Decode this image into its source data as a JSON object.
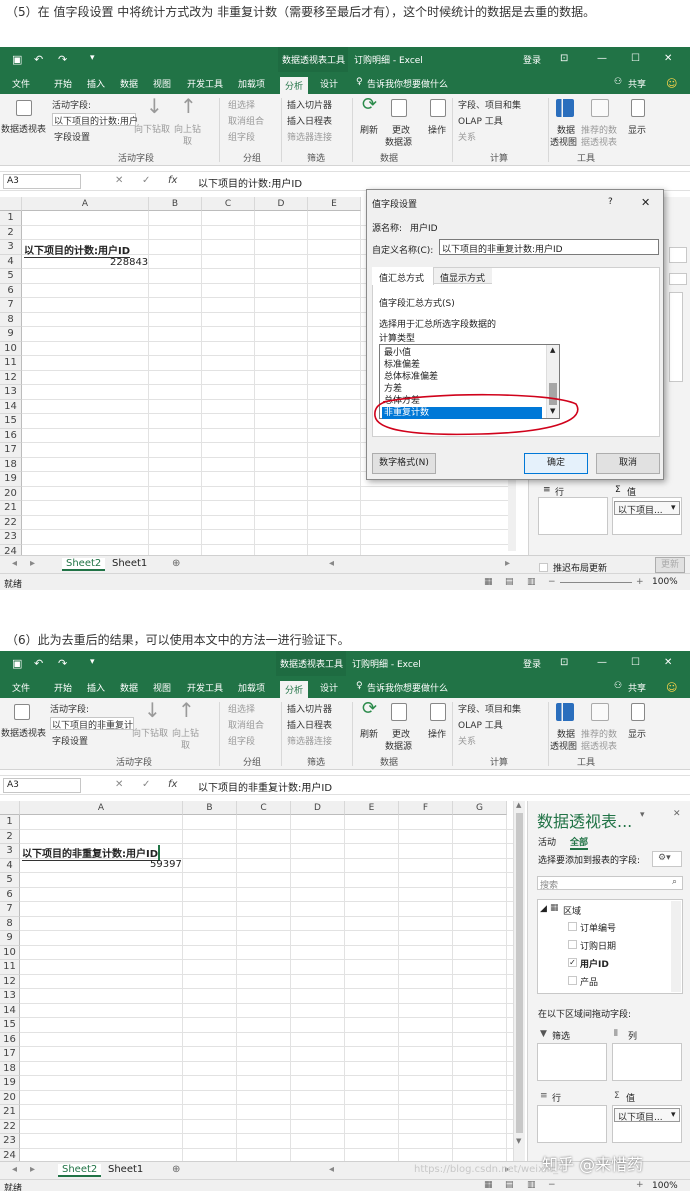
{
  "captions": {
    "step5": "（5）在 值字段设置 中将统计方式改为  非重复计数（需要移至最后才有），这个时候统计的数据是去重的数据。",
    "step6": "（6）此为去重后的结果，可以使用本文中的方法一进行验证下。"
  },
  "excel": {
    "context_tab": "数据透视表工具",
    "window_title": "订购明细 - Excel",
    "login": "登录",
    "tabs": [
      "文件",
      "开始",
      "插入",
      "数据",
      "视图",
      "开发工具",
      "加载项",
      "分析",
      "设计"
    ],
    "active_tab": "分析",
    "tell_me": "告诉我你想要做什么",
    "share": "共享",
    "ribbon": {
      "pivot_table": "数据透视表",
      "active_field_label": "活动字段:",
      "field_settings": "字段设置",
      "drill_down": "向下钻取",
      "drill_up": "向上钻",
      "drill_up2": "取",
      "group_selection": "组选择",
      "ungroup": "取消组合",
      "group_field": "组字段",
      "insert_slicer": "插入切片器",
      "insert_timeline": "插入日程表",
      "filter_connections": "筛选器连接",
      "refresh": "刷新",
      "change_source": "更改",
      "change_source2": "数据源",
      "actions": "操作",
      "fields_items_sets": "字段、项目和集",
      "olap_tools": "OLAP 工具",
      "relationships": "关系",
      "pivot_chart": "数据",
      "pivot_chart2": "透视图",
      "recommended": "推荐的数",
      "recommended2": "据透视表",
      "show": "显示",
      "groups": [
        "活动字段",
        "分组",
        "筛选",
        "数据",
        "计算",
        "工具"
      ]
    },
    "name_box": "A3",
    "columns": [
      "A",
      "B",
      "C",
      "D",
      "E",
      "F",
      "G"
    ],
    "rows": [
      "1",
      "2",
      "3",
      "4",
      "5",
      "6",
      "7",
      "8",
      "9",
      "10",
      "11",
      "12",
      "13",
      "14",
      "15",
      "16",
      "17",
      "18",
      "19",
      "20",
      "21",
      "22",
      "23",
      "24"
    ],
    "sheet_tabs": [
      "Sheet2",
      "Sheet1"
    ],
    "status_ready": "就绪",
    "zoom": "100%"
  },
  "shot1": {
    "active_field_value": "以下项目的计数:用户",
    "formula": "以下项目的计数:用户ID",
    "a3": "以下项目的计数:用户ID",
    "a4": "228843",
    "pane_row": "行",
    "pane_values": "值",
    "pane_values_item": "以下项目...",
    "defer_update": "推迟布局更新",
    "update": "更新",
    "dialog": {
      "title": "值字段设置",
      "help": "?",
      "close": "✕",
      "source_label": "源名称:",
      "source_value": "用户ID",
      "custom_label": "自定义名称(C):",
      "custom_value": "以下项目的非重复计数:用户ID",
      "tab_summarize": "值汇总方式",
      "tab_show": "值显示方式",
      "section": "值字段汇总方式(S)",
      "hint1": "选择用于汇总所选字段数据的",
      "hint2": "计算类型",
      "options": [
        "最小值",
        "标准偏差",
        "总体标准偏差",
        "方差",
        "总体方差",
        "非重复计数"
      ],
      "selected_option": "非重复计数",
      "number_format": "数字格式(N)",
      "ok": "确定",
      "cancel": "取消",
      "annotation_color": "#d0021b"
    }
  },
  "shot2": {
    "active_field_value": "以下项目的非重复计",
    "formula": "以下项目的非重复计数:用户ID",
    "a3": "以下项目的非重复计数:用户ID",
    "a4": "59397",
    "pane": {
      "title": "数据透视表...",
      "tab_active": "活动",
      "tab_all": "全部",
      "choose": "选择要添加到报表的字段:",
      "search": "搜索",
      "table": "区域",
      "fields": [
        {
          "label": "订单编号",
          "checked": false
        },
        {
          "label": "订购日期",
          "checked": false
        },
        {
          "label": "用户ID",
          "checked": true
        },
        {
          "label": "产品",
          "checked": false
        }
      ],
      "drag_hint": "在以下区域间拖动字段:",
      "filters": "筛选",
      "columns": "列",
      "rows": "行",
      "values": "值",
      "values_item": "以下项目..."
    },
    "watermark": "知乎 @来惜药",
    "url_watermark": "https://blog.csdn.net/weixin_4"
  }
}
